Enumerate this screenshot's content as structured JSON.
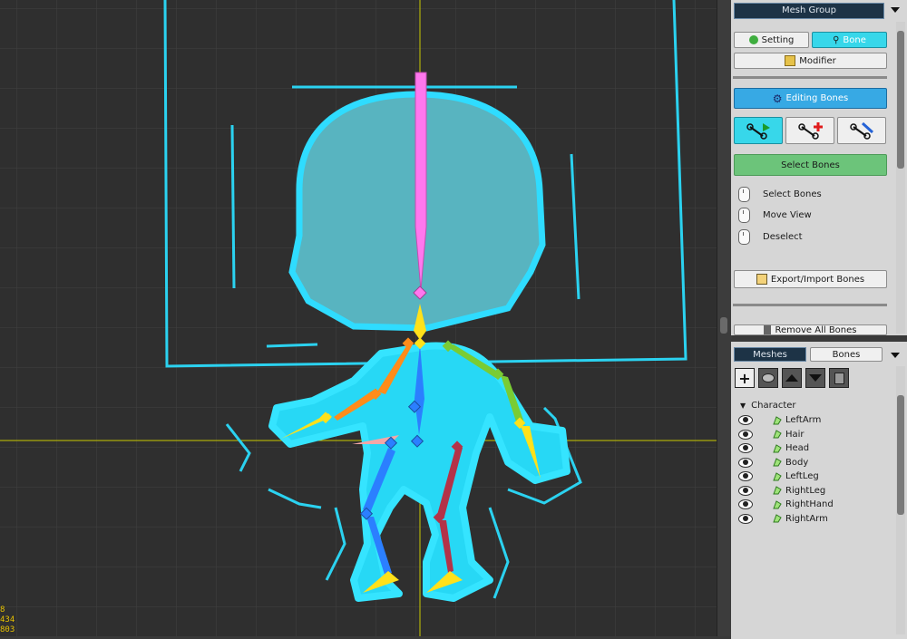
{
  "viewport": {
    "coords": [
      "8",
      "434",
      "803"
    ],
    "colors": {
      "background": "#2f2f2f",
      "grid": "#3f3f3f",
      "mesh": "#2ee6ff",
      "crosshair": "#d6d600"
    },
    "bones": [
      {
        "name": "head-bone",
        "color": "#ff66e6"
      },
      {
        "name": "neck-bone",
        "color": "#ffe11a"
      },
      {
        "name": "spine-bone",
        "color": "#2b7fff"
      },
      {
        "name": "left-arm-bone",
        "color": "#ff8c1a"
      },
      {
        "name": "right-arm-bone",
        "color": "#7acc33"
      },
      {
        "name": "left-leg-bone",
        "color": "#2b7fff"
      },
      {
        "name": "right-leg-bone",
        "color": "#b33348"
      }
    ]
  },
  "top_panel": {
    "title": "Mesh Group",
    "setting_label": "Setting",
    "bone_label": "Bone",
    "modifier_label": "Modifier",
    "editing_bones_label": "Editing Bones",
    "tool_buttons": [
      "select-bone-tool",
      "add-bone-tool",
      "link-bone-tool"
    ],
    "mode_label": "Select Bones",
    "hints": [
      "Select Bones",
      "Move View",
      "Deselect"
    ],
    "export_import_label": "Export/Import Bones",
    "remove_all_label": "Remove All Bones",
    "accent_color": "#37d7ea"
  },
  "bottom_panel": {
    "tabs": [
      "Meshes",
      "Bones"
    ],
    "active_tab": "Meshes",
    "toolbar": [
      "add-icon",
      "layer-icon",
      "move-up-icon",
      "move-down-icon",
      "delete-icon"
    ],
    "tree_root": "Character",
    "meshes": [
      "LeftArm",
      "Hair",
      "Head",
      "Body",
      "LeftLeg",
      "RightLeg",
      "RightHand",
      "RightArm"
    ]
  }
}
